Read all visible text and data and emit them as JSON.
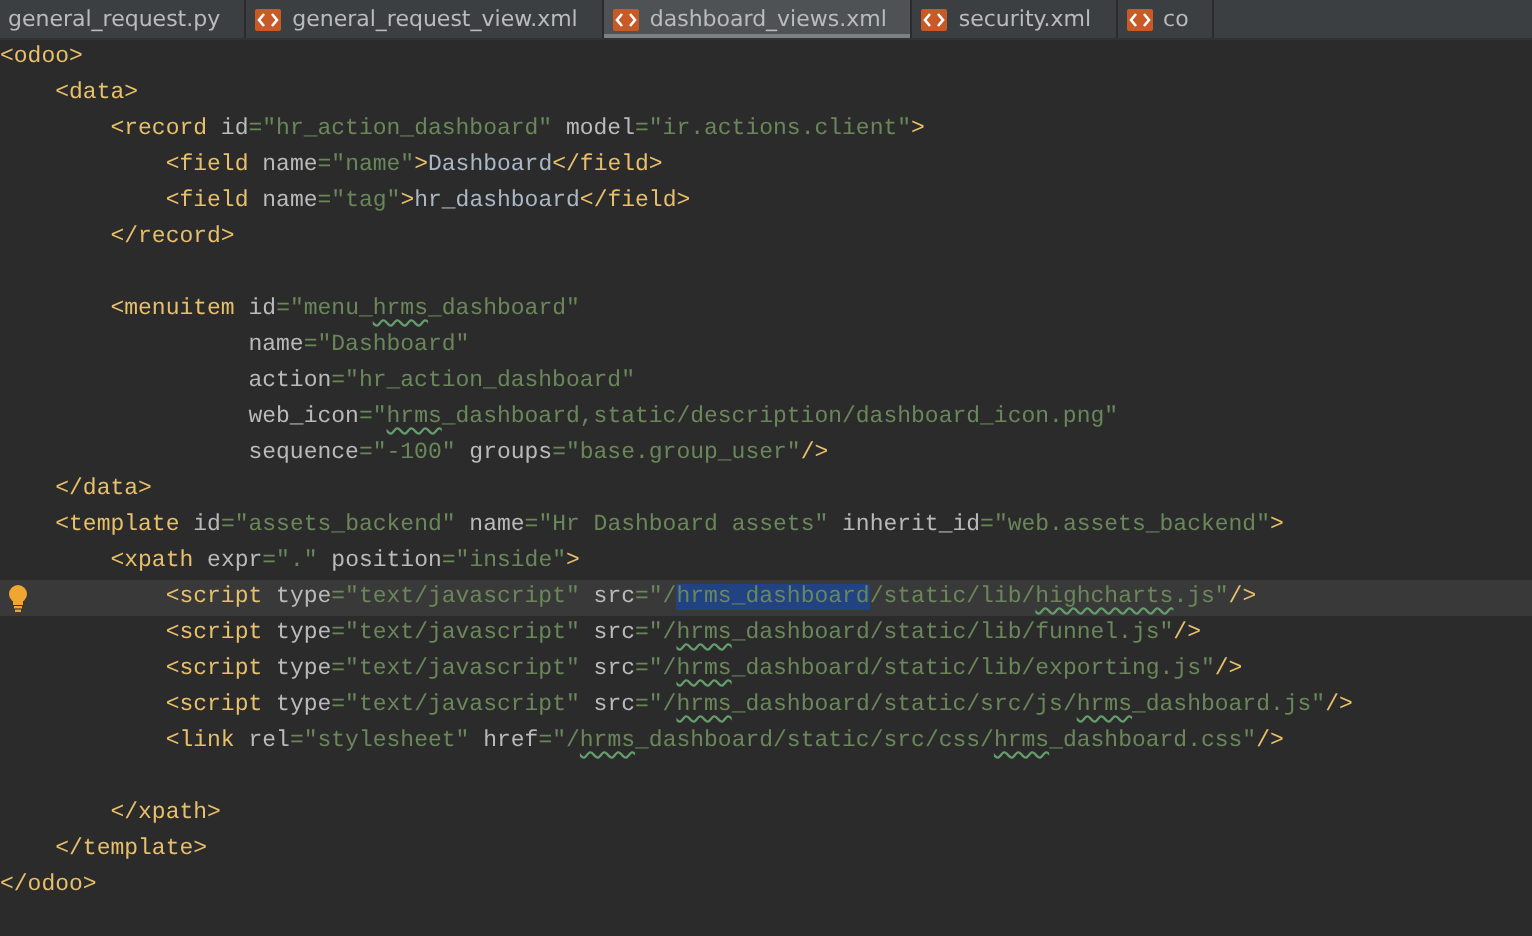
{
  "tabs": [
    {
      "label": "general_request.py",
      "kind": "plain",
      "selected": false
    },
    {
      "label": "general_request_view.xml",
      "kind": "xml",
      "selected": false
    },
    {
      "label": "dashboard_views.xml",
      "kind": "xml",
      "selected": true
    },
    {
      "label": "security.xml",
      "kind": "xml",
      "selected": false
    },
    {
      "label": "co",
      "kind": "xml",
      "selected": false
    }
  ],
  "editor": {
    "lines": [
      {
        "kind": "code",
        "current": false,
        "bulb": false,
        "tokens": [
          {
            "kind": "tag",
            "text": "<odoo>"
          }
        ],
        "children": [
          {
            "kind": "code",
            "current": false,
            "bulb": false,
            "tokens": [
              {
                "kind": "tag",
                "text": "<data>"
              }
            ],
            "children": [
              {
                "kind": "code",
                "current": false,
                "bulb": false,
                "tokens": [
                  {
                    "kind": "tag",
                    "text": "<record"
                  },
                  {
                    "kind": "attr",
                    "text": " id"
                  },
                  {
                    "kind": "value",
                    "text": "=\"hr_action_dashboard\""
                  },
                  {
                    "kind": "attr",
                    "text": " model"
                  },
                  {
                    "kind": "value",
                    "text": "=\"ir.actions.client\""
                  },
                  {
                    "kind": "tag",
                    "text": ">"
                  }
                ],
                "children": [
                  {
                    "kind": "code",
                    "current": false,
                    "bulb": false,
                    "tokens": [
                      {
                        "kind": "tag",
                        "text": "<field"
                      },
                      {
                        "kind": "attr",
                        "text": " name"
                      },
                      {
                        "kind": "value",
                        "text": "=\"name\""
                      },
                      {
                        "kind": "tag",
                        "text": ">"
                      },
                      {
                        "kind": "text",
                        "text": "Dashboard"
                      },
                      {
                        "kind": "tag",
                        "text": "</field>"
                      }
                    ]
                  },
                  {
                    "kind": "code",
                    "current": false,
                    "bulb": false,
                    "tokens": [
                      {
                        "kind": "tag",
                        "text": "<field"
                      },
                      {
                        "kind": "attr",
                        "text": " name"
                      },
                      {
                        "kind": "value",
                        "text": "=\"tag\""
                      },
                      {
                        "kind": "tag",
                        "text": ">"
                      },
                      {
                        "kind": "text",
                        "text": "hr_dashboard"
                      },
                      {
                        "kind": "tag",
                        "text": "</field>"
                      }
                    ]
                  }
                ]
              },
              {
                "kind": "code",
                "current": false,
                "bulb": false,
                "tokens": [
                  {
                    "kind": "tag",
                    "text": "</record>"
                  }
                ]
              },
              {
                "kind": "blank",
                "current": false,
                "bulb": false
              },
              {
                "kind": "code",
                "current": false,
                "bulb": false,
                "tokens": [
                  {
                    "kind": "tag",
                    "text": "<menuitem"
                  },
                  {
                    "kind": "attr",
                    "text": " id"
                  },
                  {
                    "kind": "value",
                    "text": "=\"menu_"
                  },
                  {
                    "kind": "typo",
                    "text": "hrms"
                  },
                  {
                    "kind": "value",
                    "text": "_dashboard\""
                  }
                ],
                "children": [
                  {
                    "kind": "continuation",
                    "current": false,
                    "bulb": false,
                    "tokens": [
                      {
                        "kind": "attr",
                        "text": " name"
                      },
                      {
                        "kind": "value",
                        "text": "=\"Dashboard\""
                      }
                    ]
                  },
                  {
                    "kind": "continuation",
                    "current": false,
                    "bulb": false,
                    "tokens": [
                      {
                        "kind": "attr",
                        "text": " action"
                      },
                      {
                        "kind": "value",
                        "text": "=\"hr_action_dashboard\""
                      }
                    ]
                  },
                  {
                    "kind": "continuation",
                    "current": false,
                    "bulb": false,
                    "tokens": [
                      {
                        "kind": "attr",
                        "text": " web_icon"
                      },
                      {
                        "kind": "value",
                        "text": "=\""
                      },
                      {
                        "kind": "typo",
                        "text": "hrms"
                      },
                      {
                        "kind": "value",
                        "text": "_dashboard,static/description/dashboard_icon.png\""
                      }
                    ]
                  },
                  {
                    "kind": "continuation",
                    "current": false,
                    "bulb": false,
                    "tokens": [
                      {
                        "kind": "attr",
                        "text": " sequence"
                      },
                      {
                        "kind": "value",
                        "text": "=\"-100\""
                      },
                      {
                        "kind": "attr",
                        "text": " groups"
                      },
                      {
                        "kind": "value",
                        "text": "=\"base.group_user\""
                      },
                      {
                        "kind": "tag",
                        "text": "/>"
                      }
                    ]
                  }
                ]
              }
            ]
          },
          {
            "kind": "code",
            "current": false,
            "bulb": false,
            "tokens": [
              {
                "kind": "tag",
                "text": "</data>"
              }
            ]
          },
          {
            "kind": "code",
            "current": false,
            "bulb": false,
            "tokens": [
              {
                "kind": "tag",
                "text": "<template"
              },
              {
                "kind": "attr",
                "text": " id"
              },
              {
                "kind": "value",
                "text": "=\"assets_backend\""
              },
              {
                "kind": "attr",
                "text": " name"
              },
              {
                "kind": "value",
                "text": "=\"Hr Dashboard assets\""
              },
              {
                "kind": "attr",
                "text": " inherit_id"
              },
              {
                "kind": "value",
                "text": "=\"web.assets_backend\""
              },
              {
                "kind": "tag",
                "text": ">"
              }
            ],
            "children": [
              {
                "kind": "code",
                "current": false,
                "bulb": false,
                "tokens": [
                  {
                    "kind": "tag",
                    "text": "<xpath"
                  },
                  {
                    "kind": "attr",
                    "text": " expr"
                  },
                  {
                    "kind": "value",
                    "text": "=\".\""
                  },
                  {
                    "kind": "attr",
                    "text": " position"
                  },
                  {
                    "kind": "value",
                    "text": "=\"inside\""
                  },
                  {
                    "kind": "tag",
                    "text": ">"
                  }
                ],
                "children": [
                  {
                    "kind": "code",
                    "current": true,
                    "bulb": true,
                    "tokens": [
                      {
                        "kind": "tag",
                        "text": "<script"
                      },
                      {
                        "kind": "attr",
                        "text": " type"
                      },
                      {
                        "kind": "value",
                        "text": "=\"text/javascript\""
                      },
                      {
                        "kind": "attr",
                        "text": " src"
                      },
                      {
                        "kind": "value",
                        "text": "=\"/"
                      },
                      {
                        "kind": "selection",
                        "text": "hrms_dashboard"
                      },
                      {
                        "kind": "value",
                        "text": "/static/lib/"
                      },
                      {
                        "kind": "typo",
                        "text": "highcharts"
                      },
                      {
                        "kind": "value",
                        "text": ".js\""
                      },
                      {
                        "kind": "tag",
                        "text": "/>"
                      }
                    ]
                  },
                  {
                    "kind": "code",
                    "current": false,
                    "bulb": false,
                    "tokens": [
                      {
                        "kind": "tag",
                        "text": "<script"
                      },
                      {
                        "kind": "attr",
                        "text": " type"
                      },
                      {
                        "kind": "value",
                        "text": "=\"text/javascript\""
                      },
                      {
                        "kind": "attr",
                        "text": " src"
                      },
                      {
                        "kind": "value",
                        "text": "=\"/"
                      },
                      {
                        "kind": "typo",
                        "text": "hrms"
                      },
                      {
                        "kind": "value",
                        "text": "_dashboard/static/lib/funnel.js\""
                      },
                      {
                        "kind": "tag",
                        "text": "/>"
                      }
                    ]
                  },
                  {
                    "kind": "code",
                    "current": false,
                    "bulb": false,
                    "tokens": [
                      {
                        "kind": "tag",
                        "text": "<script"
                      },
                      {
                        "kind": "attr",
                        "text": " type"
                      },
                      {
                        "kind": "value",
                        "text": "=\"text/javascript\""
                      },
                      {
                        "kind": "attr",
                        "text": " src"
                      },
                      {
                        "kind": "value",
                        "text": "=\"/"
                      },
                      {
                        "kind": "typo",
                        "text": "hrms"
                      },
                      {
                        "kind": "value",
                        "text": "_dashboard/static/lib/exporting.js\""
                      },
                      {
                        "kind": "tag",
                        "text": "/>"
                      }
                    ]
                  },
                  {
                    "kind": "code",
                    "current": false,
                    "bulb": false,
                    "tokens": [
                      {
                        "kind": "tag",
                        "text": "<script"
                      },
                      {
                        "kind": "attr",
                        "text": " type"
                      },
                      {
                        "kind": "value",
                        "text": "=\"text/javascript\""
                      },
                      {
                        "kind": "attr",
                        "text": " src"
                      },
                      {
                        "kind": "value",
                        "text": "=\"/"
                      },
                      {
                        "kind": "typo",
                        "text": "hrms"
                      },
                      {
                        "kind": "value",
                        "text": "_dashboard/static/src/js/"
                      },
                      {
                        "kind": "typo",
                        "text": "hrms"
                      },
                      {
                        "kind": "value",
                        "text": "_dashboard.js\""
                      },
                      {
                        "kind": "tag",
                        "text": "/>"
                      }
                    ]
                  },
                  {
                    "kind": "code",
                    "current": false,
                    "bulb": false,
                    "tokens": [
                      {
                        "kind": "tag",
                        "text": "<link"
                      },
                      {
                        "kind": "attr",
                        "text": " rel"
                      },
                      {
                        "kind": "value",
                        "text": "=\"stylesheet\""
                      },
                      {
                        "kind": "attr",
                        "text": " href"
                      },
                      {
                        "kind": "value",
                        "text": "=\"/"
                      },
                      {
                        "kind": "typo",
                        "text": "hrms"
                      },
                      {
                        "kind": "value",
                        "text": "_dashboard/static/src/css/"
                      },
                      {
                        "kind": "typo",
                        "text": "hrms"
                      },
                      {
                        "kind": "value",
                        "text": "_dashboard.css\""
                      },
                      {
                        "kind": "tag",
                        "text": "/>"
                      }
                    ]
                  },
                  {
                    "kind": "blank",
                    "current": false,
                    "bulb": false
                  }
                ]
              },
              {
                "kind": "code",
                "current": false,
                "bulb": false,
                "tokens": [
                  {
                    "kind": "tag",
                    "text": "</xpath>"
                  }
                ]
              }
            ]
          },
          {
            "kind": "code",
            "current": false,
            "bulb": false,
            "tokens": [
              {
                "kind": "tag",
                "text": "</template>"
              }
            ]
          }
        ]
      },
      {
        "kind": "code",
        "current": false,
        "bulb": false,
        "tokens": [
          {
            "kind": "tag",
            "text": "</odoo>"
          }
        ]
      }
    ]
  }
}
